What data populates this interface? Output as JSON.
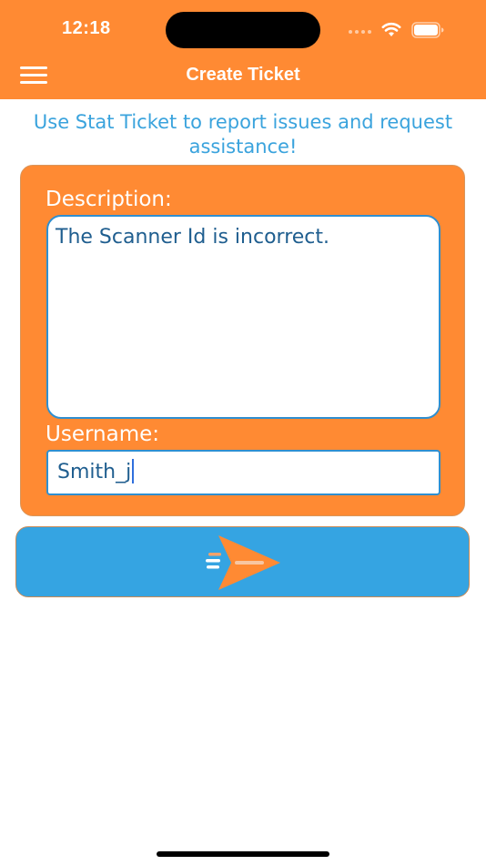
{
  "status_bar": {
    "time": "12:18"
  },
  "header": {
    "title": "Create Ticket",
    "menu_icon": "hamburger-menu-icon",
    "background_color": "#ff8a33"
  },
  "intro": {
    "text": "Use Stat Ticket to report issues and request assistance!",
    "color": "#3aa3dd"
  },
  "form": {
    "description_label": "Description:",
    "description_value": "The Scanner Id is incorrect.",
    "username_label": "Username:",
    "username_value": "Smith_j"
  },
  "submit": {
    "icon": "send-paper-plane-icon",
    "background_color": "#35a4e2"
  }
}
